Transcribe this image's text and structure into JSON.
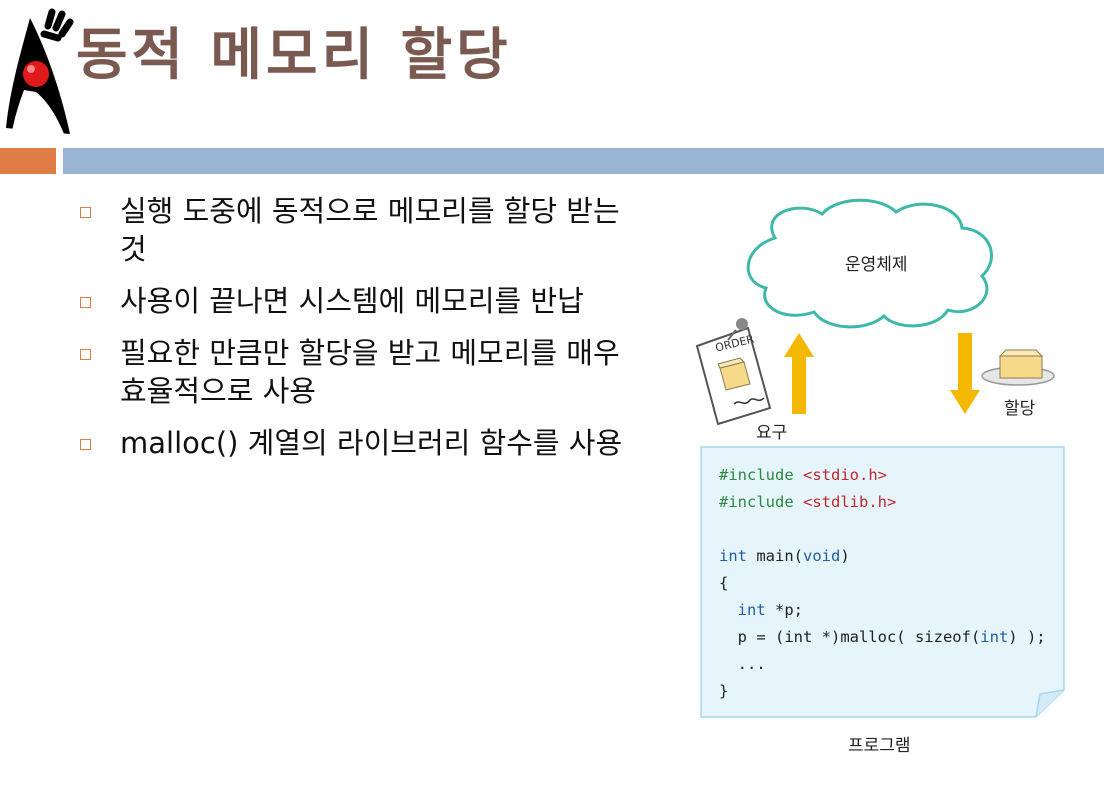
{
  "header": {
    "title": "동적 메모리 할당"
  },
  "bullets": [
    {
      "text": "실행 도중에 동적으로 메모리를 할당 받는 것"
    },
    {
      "text": "사용이 끝나면 시스템에 메모리를 반납"
    },
    {
      "text": "필요한 만큼만 할당을 받고 메모리를 매우 효율적으로 사용"
    },
    {
      "text": "malloc() 계열의 라이브러리 함수를 사용"
    }
  ],
  "diagram": {
    "os_label": "운영체제",
    "order_label": "ORDER",
    "request_label": "요구",
    "alloc_label": "할당",
    "program_label": "프로그램"
  },
  "code": {
    "line1": {
      "directive": "#include",
      "header": "<stdio.h>"
    },
    "line2": {
      "directive": "#include",
      "header": "<stdlib.h>"
    },
    "line4": {
      "kw": "int",
      "mid": " main(",
      "kw2": "void",
      "end": ")"
    },
    "line5": "{",
    "line6": {
      "indent": "  ",
      "kw": "int",
      "rest": " *p;"
    },
    "line7": {
      "a": "  p = (int *)malloc( sizeof(",
      "kw": "int",
      "b": ") );"
    },
    "line8": "  ...",
    "line9": "}"
  },
  "colors": {
    "title": "#7a5a50",
    "accent_orange": "#e07c45",
    "accent_blue": "#9ab5d3",
    "cloud_stroke": "#3fb8a8",
    "arrow_yellow": "#f5b800",
    "code_bg": "#e6f4fb",
    "code_border": "#a9d5ec"
  }
}
